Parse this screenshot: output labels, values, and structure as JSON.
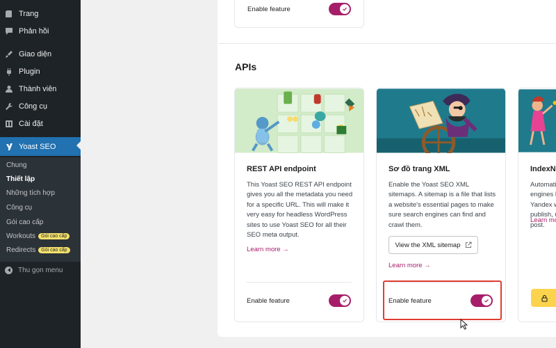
{
  "sidebar": {
    "items": [
      {
        "label": "Trang",
        "icon": "pages-icon"
      },
      {
        "label": "Phản hồi",
        "icon": "comments-icon"
      },
      {
        "label": "Giao diện",
        "icon": "appearance-icon"
      },
      {
        "label": "Plugin",
        "icon": "plugins-icon"
      },
      {
        "label": "Thành viên",
        "icon": "users-icon"
      },
      {
        "label": "Công cụ",
        "icon": "tools-icon"
      },
      {
        "label": "Cài đặt",
        "icon": "settings-icon"
      },
      {
        "label": "Yoast SEO",
        "icon": "yoast-icon"
      }
    ],
    "submenu": [
      {
        "label": "Chung"
      },
      {
        "label": "Thiết lập"
      },
      {
        "label": "Những tích hợp"
      },
      {
        "label": "Công cụ"
      },
      {
        "label": "Gói cao cấp"
      },
      {
        "label": "Workouts",
        "badge": "Gói cao cấp"
      },
      {
        "label": "Redirects",
        "badge": "Gói cao cấp"
      }
    ],
    "collapse_label": "Thu gọn menu"
  },
  "top_card": {
    "enable_label": "Enable feature"
  },
  "section": {
    "title": "APIs"
  },
  "cards": [
    {
      "title": "REST API endpoint",
      "description": "This Yoast SEO REST API endpoint gives you all the metadata you need for a specific URL. This will make it very easy for headless WordPress sites to use Yoast SEO for all their SEO meta output.",
      "learn_more": "Learn more →",
      "enable_label": "Enable feature",
      "enabled": true
    },
    {
      "title": "Sơ đồ trang XML",
      "description": "Enable the Yoast SEO XML sitemaps. A sitemap is a file that lists a website's essential pages to make sure search engines can find and crawl them.",
      "button_label": "View the XML sitemap",
      "learn_more": "Learn more →",
      "enable_label": "Enable feature",
      "enabled": true
    },
    {
      "title": "IndexNow",
      "description": "Automatically ping search engines like Bing and Yandex whenever you publish, update or delete a post.",
      "learn_more": "Learn more →"
    }
  ],
  "colors": {
    "accent": "#a61e69",
    "sidebar_bg": "#1d2327",
    "active_menu": "#2271b1",
    "highlight": "#e03c31",
    "premium": "#fcd34d"
  }
}
